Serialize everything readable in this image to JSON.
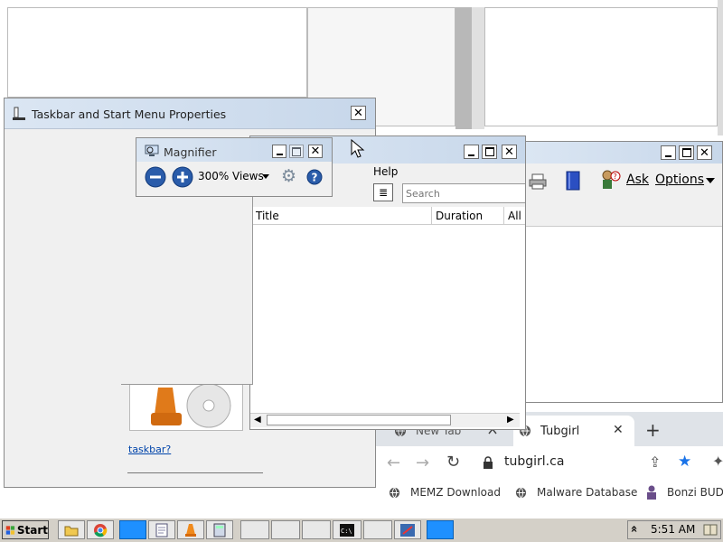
{
  "taskbar_props": {
    "title": "Taskbar and Start Menu Properties",
    "link_text": "taskbar?"
  },
  "magnifier": {
    "title": "Magnifier",
    "zoom": "300%",
    "views_label": "Views"
  },
  "media_window": {
    "menu_help": "Help",
    "search_placeholder": "Search",
    "columns": [
      "Title",
      "Duration",
      "All"
    ]
  },
  "right_window": {
    "ask_label": "Ask",
    "options_label": "Options"
  },
  "browser": {
    "tabs": [
      {
        "label": "New Tab",
        "active": false
      },
      {
        "label": "Tubgirl",
        "active": true
      }
    ],
    "new_tab": "+",
    "url": "tubgirl.ca",
    "bookmarks": [
      "MEMZ Download",
      "Malware Database",
      "Bonzi BUD"
    ]
  },
  "taskbar": {
    "start_label": "Start",
    "clock": "5:51 AM",
    "chevron": "»"
  },
  "icons": [
    "cursor-arrow",
    "magnifier-icon",
    "zoom-out-icon",
    "zoom-in-icon",
    "gear-icon",
    "help-icon",
    "printer-icon",
    "book-icon",
    "ask-icon",
    "globe-icon",
    "lock-icon",
    "star-icon"
  ],
  "colors": {
    "taskbar_bg": "#d4d0c8",
    "title_grad": "#dbe6f3",
    "task_blue": "#1e90ff"
  }
}
